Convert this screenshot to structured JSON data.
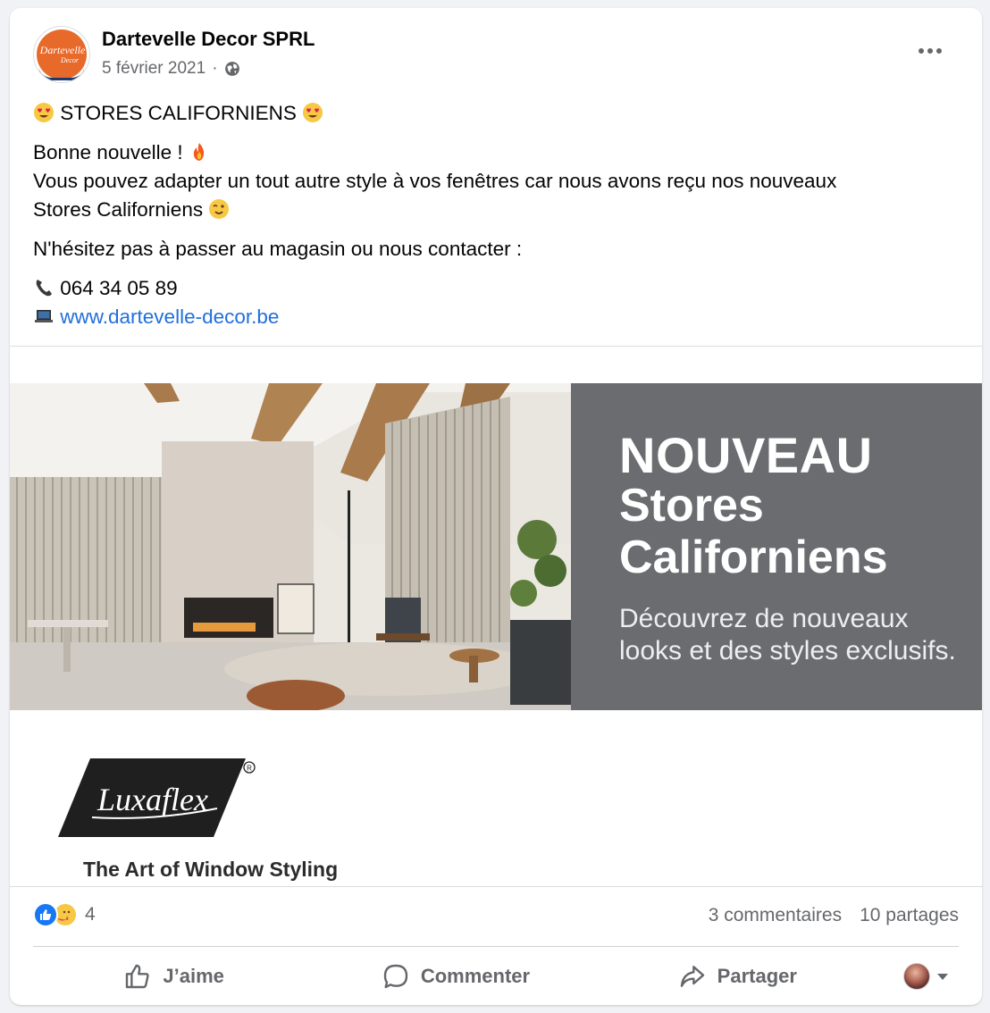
{
  "post": {
    "page_name": "Dartevelle Decor SPRL",
    "date": "5 février 2021",
    "separator": "·",
    "visibility_icon": "globe-icon",
    "avatar_text_1": "Dartevelle",
    "avatar_text_2": "Decor",
    "line_title": "STORES CALIFORNIENS",
    "line_news": "Bonne nouvelle !",
    "line_body_1": "Vous pouvez adapter un tout autre style à vos fenêtres car nous avons reçu nos nouveaux",
    "line_body_2": "Stores Californiens",
    "line_contact": "N'hésitez pas à passer au magasin ou nous contacter :",
    "phone": "064 34 05 89",
    "website": "www.dartevelle-decor.be"
  },
  "banner": {
    "headline": "NOUVEAU",
    "subline_1": "Stores",
    "subline_2": "Californiens",
    "tagline_1": "Découvrez de nouveaux",
    "tagline_2": "looks et des styles exclusifs.",
    "panel_color": "#6b6c70"
  },
  "brand": {
    "logo_text": "Luxaflex",
    "registered": "®",
    "slogan": "The Art of Window Styling"
  },
  "engagement": {
    "reaction_count": "4",
    "comments": "3 commentaires",
    "shares": "10 partages"
  },
  "actions": {
    "like": "J’aime",
    "comment": "Commenter",
    "share": "Partager"
  },
  "colors": {
    "accent": "#1877f2",
    "link": "#216fdb",
    "secondary_text": "#65676b"
  }
}
